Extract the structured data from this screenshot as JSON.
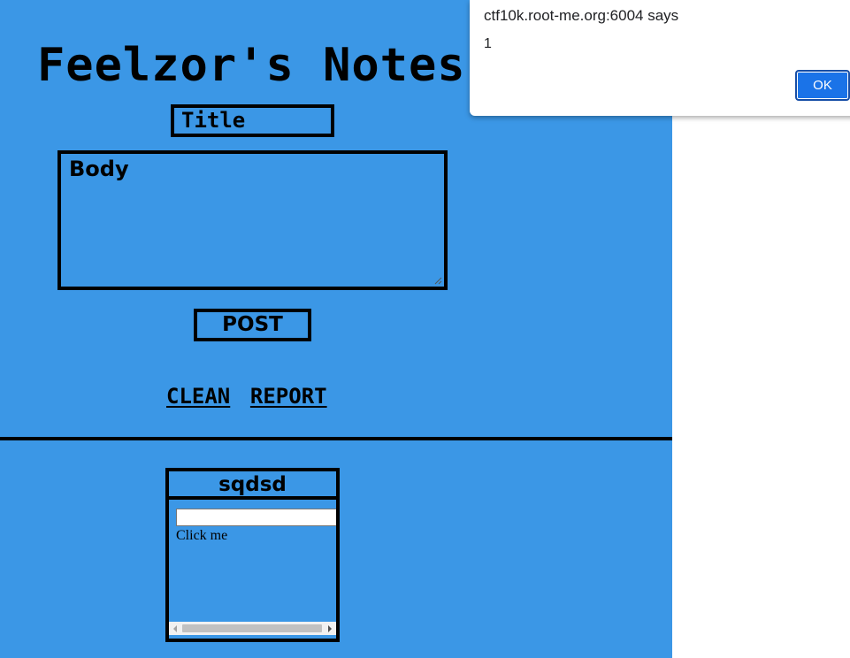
{
  "app": {
    "title": "Feelzor's Notes",
    "title_placeholder": "Title",
    "body_placeholder": "Body",
    "post_label": "POST",
    "clean_label": "CLEAN",
    "report_label": "REPORT",
    "background_color": "#3b97e6"
  },
  "note": {
    "title": "sqdsd",
    "click_text": "Click me"
  },
  "dialog": {
    "origin": "ctf10k.root-me.org:6004 says",
    "message": "1",
    "ok_label": "OK",
    "button_color": "#1a73e8"
  }
}
